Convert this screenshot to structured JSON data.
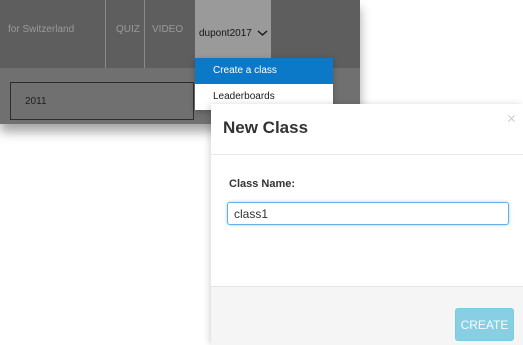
{
  "background": {
    "nav": {
      "site_title": "for Switzerland",
      "links": [
        "QUIZ",
        "VIDEO"
      ],
      "user": "dupont2017"
    },
    "user_menu": {
      "items": [
        "Create a class",
        "Leaderboards"
      ],
      "active": "Create a class"
    },
    "year_field": "2011"
  },
  "modal": {
    "title": "New Class",
    "field_label": "Class Name:",
    "class_name_value": "class1",
    "create_label": "CREATE",
    "primary_color": "#5bc0de"
  }
}
